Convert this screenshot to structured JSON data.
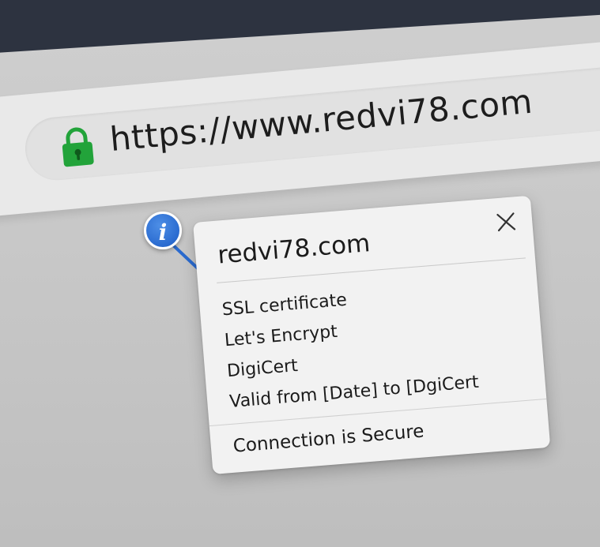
{
  "address_bar": {
    "url": "https://www.redvi78.com",
    "lock_icon": "lock-icon",
    "lock_color": "#22a33a"
  },
  "info_marker": {
    "icon": "info-icon",
    "glyph": "i",
    "color": "#2a6bd0"
  },
  "popup": {
    "title": "redvi78.com",
    "close_icon": "close-icon",
    "details": [
      "SSL certificate",
      "Let's Encrypt",
      "DigiCert",
      "Valid from [Date] to [DgiCert"
    ],
    "status": "Connection is Secure"
  },
  "colors": {
    "titlebar": "#2d3340",
    "toolbar": "#e9e9e9",
    "popup_bg": "#f2f2f2"
  }
}
